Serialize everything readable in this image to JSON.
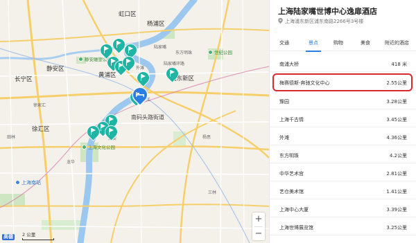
{
  "map": {
    "labels": {
      "hongkou": "虹口区",
      "yangpu": "杨浦区",
      "changning": "长宁区",
      "jingan": "静安区",
      "xuhui": "徐汇区",
      "huangpu": "黄浦区",
      "pudong": "浦东新区",
      "jingan_park": "静安雕塑公园",
      "binjiang": "滨江",
      "bund": "外滩",
      "lujiazui": "陆家嘴",
      "nanmatou": "南码头路街道",
      "shanghai_culture_park": "上海文化公园",
      "south_station": "上海南站",
      "lujiazui_huanlu": "陆家嘴环路",
      "dongfang": "东方明珠",
      "century_park": "世纪公园",
      "xujiahui": "徐家汇",
      "tianlin": "田林",
      "shuangan": "双安",
      "longhua": "龙华",
      "yangsi": "杨思",
      "sanlin": "三林"
    },
    "zoom_in": "+",
    "zoom_out": "−",
    "logo_text": "高德",
    "scale_label": "2 公里"
  },
  "panel": {
    "hotel_name": "上海陆家嘴世博中心逸扉酒店",
    "address": "上海浦东新区浦东南路2266号3号楼",
    "tabs": [
      "交通",
      "景点",
      "购物",
      "美食",
      "附近的酒店"
    ],
    "active_tab": "景点",
    "attractions": [
      {
        "name": "南浦大桥",
        "distance": "418 米"
      },
      {
        "name": "梅赛德斯-奔驰文化中心",
        "distance": "2.55公里"
      },
      {
        "name": "豫园",
        "distance": "3.28公里"
      },
      {
        "name": "上海千古情",
        "distance": "3.45公里"
      },
      {
        "name": "外滩",
        "distance": "4.36公里"
      },
      {
        "name": "东方明珠",
        "distance": "4.2公里"
      },
      {
        "name": "中华艺术宫",
        "distance": "2.81公里"
      },
      {
        "name": "艺仓美术馆",
        "distance": "1.41公里"
      },
      {
        "name": "上海中心大厦",
        "distance": "3.39公里"
      },
      {
        "name": "上海世博展览馆",
        "distance": "3.25公里"
      }
    ]
  },
  "colors": {
    "accent": "#2a7de1",
    "highlight": "#d9282f",
    "marker": "#1fb4a4"
  }
}
